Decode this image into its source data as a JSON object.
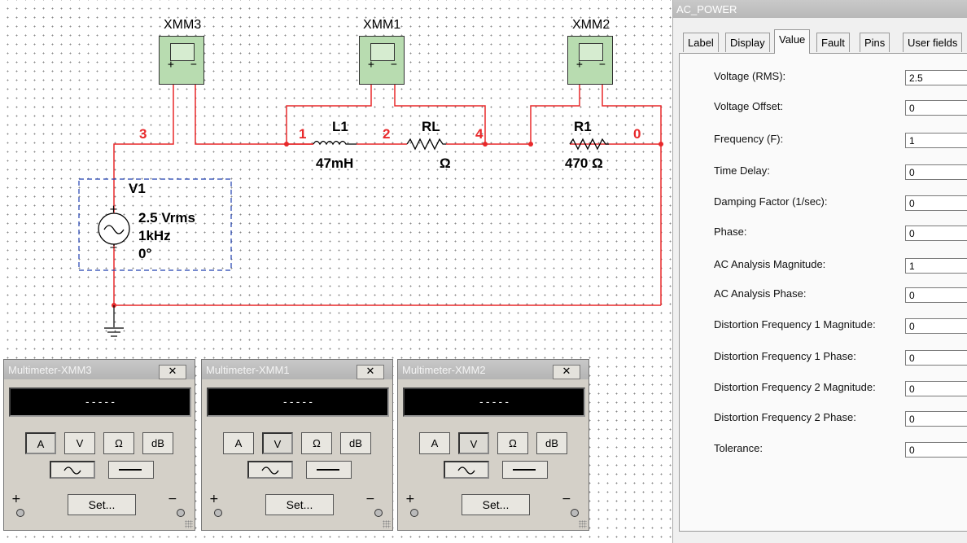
{
  "schematic": {
    "meters": [
      {
        "name": "XMM3"
      },
      {
        "name": "XMM1"
      },
      {
        "name": "XMM2"
      }
    ],
    "nodes": {
      "n3": "3",
      "n1": "1",
      "n2": "2",
      "n4": "4",
      "n0": "0"
    },
    "components": {
      "l1": {
        "name": "L1",
        "value": "47mH"
      },
      "rl": {
        "name": "RL",
        "value": "Ω"
      },
      "r1": {
        "name": "R1",
        "value": "470 Ω"
      },
      "v1": {
        "name": "V1",
        "voltage": "2.5 Vrms",
        "frequency": "1kHz",
        "phase": "0°"
      }
    },
    "wire_color": "#e8282a"
  },
  "multimeters": [
    {
      "title": "Multimeter-XMM3",
      "display": "-----",
      "buttons": [
        "A",
        "V",
        "Ω",
        "dB"
      ],
      "active_button": "A",
      "set_label": "Set...",
      "plus": "+",
      "minus": "−",
      "close": "✕"
    },
    {
      "title": "Multimeter-XMM1",
      "display": "-----",
      "buttons": [
        "A",
        "V",
        "Ω",
        "dB"
      ],
      "active_button": "V",
      "set_label": "Set...",
      "plus": "+",
      "minus": "−",
      "close": "✕"
    },
    {
      "title": "Multimeter-XMM2",
      "display": "-----",
      "buttons": [
        "A",
        "V",
        "Ω",
        "dB"
      ],
      "active_button": "V",
      "set_label": "Set...",
      "plus": "+",
      "minus": "−",
      "close": "✕"
    }
  ],
  "properties": {
    "title": "AC_POWER",
    "tabs": [
      "Label",
      "Display",
      "Value",
      "Fault",
      "Pins",
      "User fields"
    ],
    "active_tab": "Value",
    "rows": [
      {
        "label": "Voltage (RMS):",
        "value": "2.5"
      },
      {
        "label": "Voltage Offset:",
        "value": "0"
      },
      {
        "label": "Frequency (F):",
        "value": "1"
      },
      {
        "label": "Time Delay:",
        "value": "0"
      },
      {
        "label": "Damping Factor (1/sec):",
        "value": "0"
      },
      {
        "label": "Phase:",
        "value": "0"
      },
      {
        "label": "AC Analysis Magnitude:",
        "value": "1"
      },
      {
        "label": "AC Analysis Phase:",
        "value": "0"
      },
      {
        "label": "Distortion Frequency 1 Magnitude:",
        "value": "0"
      },
      {
        "label": "Distortion Frequency 1 Phase:",
        "value": "0"
      },
      {
        "label": "Distortion Frequency 2 Magnitude:",
        "value": "0"
      },
      {
        "label": "Distortion Frequency 2 Phase:",
        "value": "0"
      },
      {
        "label": "Tolerance:",
        "value": "0"
      }
    ]
  }
}
